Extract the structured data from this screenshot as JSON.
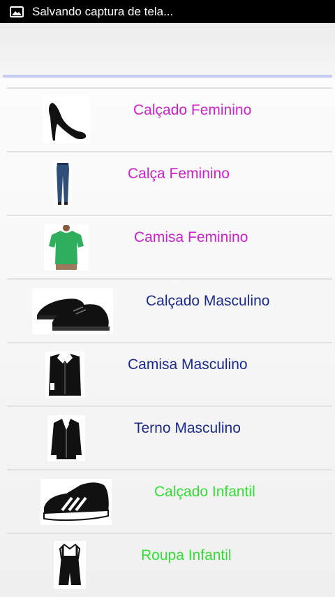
{
  "status_bar": {
    "text": "Salvando captura de tela...",
    "icon": "image-icon"
  },
  "colors": {
    "feminino": "#cc22cc",
    "masculino": "#1b2a8a",
    "infantil": "#33dd33"
  },
  "categories": [
    {
      "label": "Calçado Feminino",
      "icon": "high-heel-shoe-icon",
      "group": "feminino"
    },
    {
      "label": "Calça Feminino",
      "icon": "jeans-icon",
      "group": "feminino"
    },
    {
      "label": "Camisa Feminino",
      "icon": "green-blouse-icon",
      "group": "feminino"
    },
    {
      "label": "Calçado Masculino",
      "icon": "mens-shoes-icon",
      "group": "masculino"
    },
    {
      "label": "Camisa Masculino",
      "icon": "dress-shirt-icon",
      "group": "masculino"
    },
    {
      "label": "Terno Masculino",
      "icon": "suit-jacket-icon",
      "group": "masculino"
    },
    {
      "label": "Calçado Infantil",
      "icon": "sneaker-icon",
      "group": "infantil"
    },
    {
      "label": "Roupa Infantil",
      "icon": "kids-overalls-icon",
      "group": "infantil"
    }
  ]
}
